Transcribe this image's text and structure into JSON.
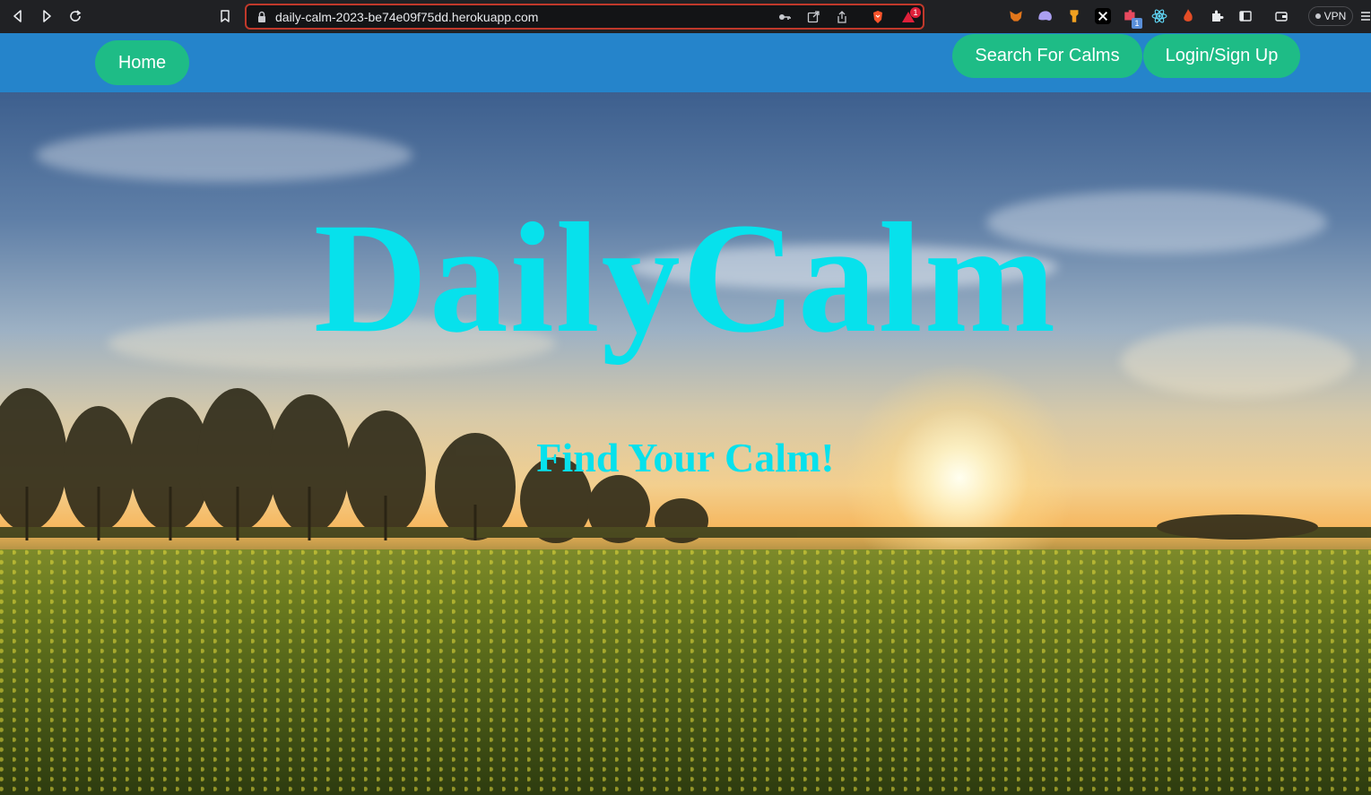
{
  "browser": {
    "url": "daily-calm-2023-be74e09f75dd.herokuapp.com",
    "notification_count": "1",
    "extension_badge": "1",
    "vpn_label": "VPN",
    "icons": [
      "back-icon",
      "forward-icon",
      "reload-icon",
      "bookmark-icon",
      "lock-icon",
      "key-icon",
      "open-external-icon",
      "share-icon",
      "brave-shield-icon",
      "brave-rewards-icon",
      "metamask-icon",
      "ghost-icon",
      "keyhole-icon",
      "x-icon",
      "puzzle-piece-icon",
      "react-icon",
      "flame-icon",
      "extensions-icon",
      "sidebar-icon",
      "wallet-icon",
      "menu-icon"
    ]
  },
  "nav": {
    "home_label": "Home",
    "search_label": "Search For Calms",
    "login_label": "Login/Sign Up"
  },
  "hero": {
    "title": "DailyCalm",
    "subtitle": "Find Your Calm!"
  },
  "colors": {
    "nav_bg": "#2584cb",
    "button_bg": "#1ebc86",
    "title_color": "#07e1ec"
  }
}
